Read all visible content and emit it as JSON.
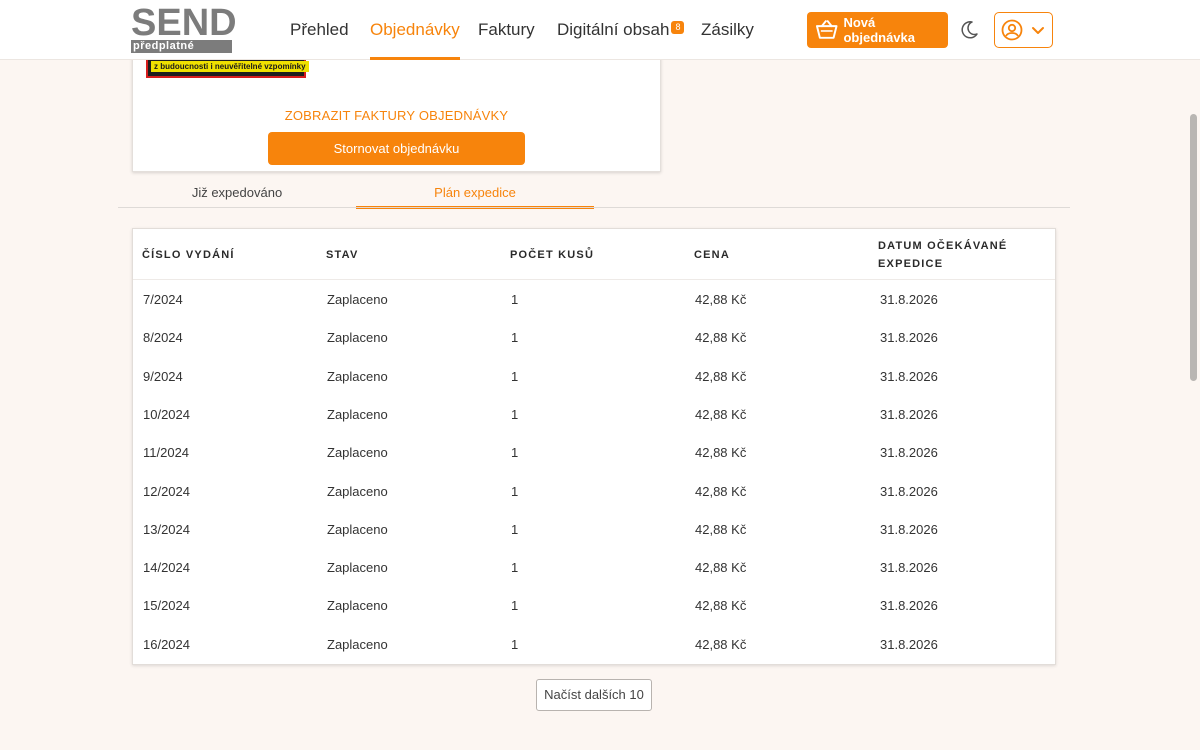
{
  "brand": {
    "line1": "SEND",
    "line2": "předplatné"
  },
  "nav": {
    "items": [
      {
        "label": "Přehled"
      },
      {
        "label": "Objednávky"
      },
      {
        "label": "Faktury"
      },
      {
        "label": "Digitální obsah",
        "badge": "8"
      },
      {
        "label": "Zásilky"
      }
    ],
    "active": "Objednávky",
    "new_order_label": "Nová objednávka"
  },
  "order_card": {
    "cover_strip_text": "z budoucnosti i neuvěřitelné vzpomínky",
    "invoices_link": "ZOBRAZIT FAKTURY OBJEDNÁVKY",
    "cancel_label": "Stornovat objednávku"
  },
  "tabs": [
    {
      "label": "Již expedováno"
    },
    {
      "label": "Plán expedice"
    }
  ],
  "active_tab": "Plán expedice",
  "table": {
    "columns": [
      "ČÍSLO VYDÁNÍ",
      "STAV",
      "POČET KUSŮ",
      "CENA",
      "DATUM OČEKÁVANÉ EXPEDICE"
    ],
    "rows": [
      [
        "7/2024",
        "Zaplaceno",
        "1",
        "42,88 Kč",
        "31.8.2026"
      ],
      [
        "8/2024",
        "Zaplaceno",
        "1",
        "42,88 Kč",
        "31.8.2026"
      ],
      [
        "9/2024",
        "Zaplaceno",
        "1",
        "42,88 Kč",
        "31.8.2026"
      ],
      [
        "10/2024",
        "Zaplaceno",
        "1",
        "42,88 Kč",
        "31.8.2026"
      ],
      [
        "11/2024",
        "Zaplaceno",
        "1",
        "42,88 Kč",
        "31.8.2026"
      ],
      [
        "12/2024",
        "Zaplaceno",
        "1",
        "42,88 Kč",
        "31.8.2026"
      ],
      [
        "13/2024",
        "Zaplaceno",
        "1",
        "42,88 Kč",
        "31.8.2026"
      ],
      [
        "14/2024",
        "Zaplaceno",
        "1",
        "42,88 Kč",
        "31.8.2026"
      ],
      [
        "15/2024",
        "Zaplaceno",
        "1",
        "42,88 Kč",
        "31.8.2026"
      ],
      [
        "16/2024",
        "Zaplaceno",
        "1",
        "42,88 Kč",
        "31.8.2026"
      ]
    ]
  },
  "load_more_label": "Načíst dalších 10",
  "icons": {
    "basket": "basket-icon",
    "theme": "moon-icon",
    "user": "user-circle-icon",
    "dropdown": "chevron-down-icon"
  },
  "colors": {
    "accent": "#f7840c",
    "background": "#fcf6f2"
  }
}
